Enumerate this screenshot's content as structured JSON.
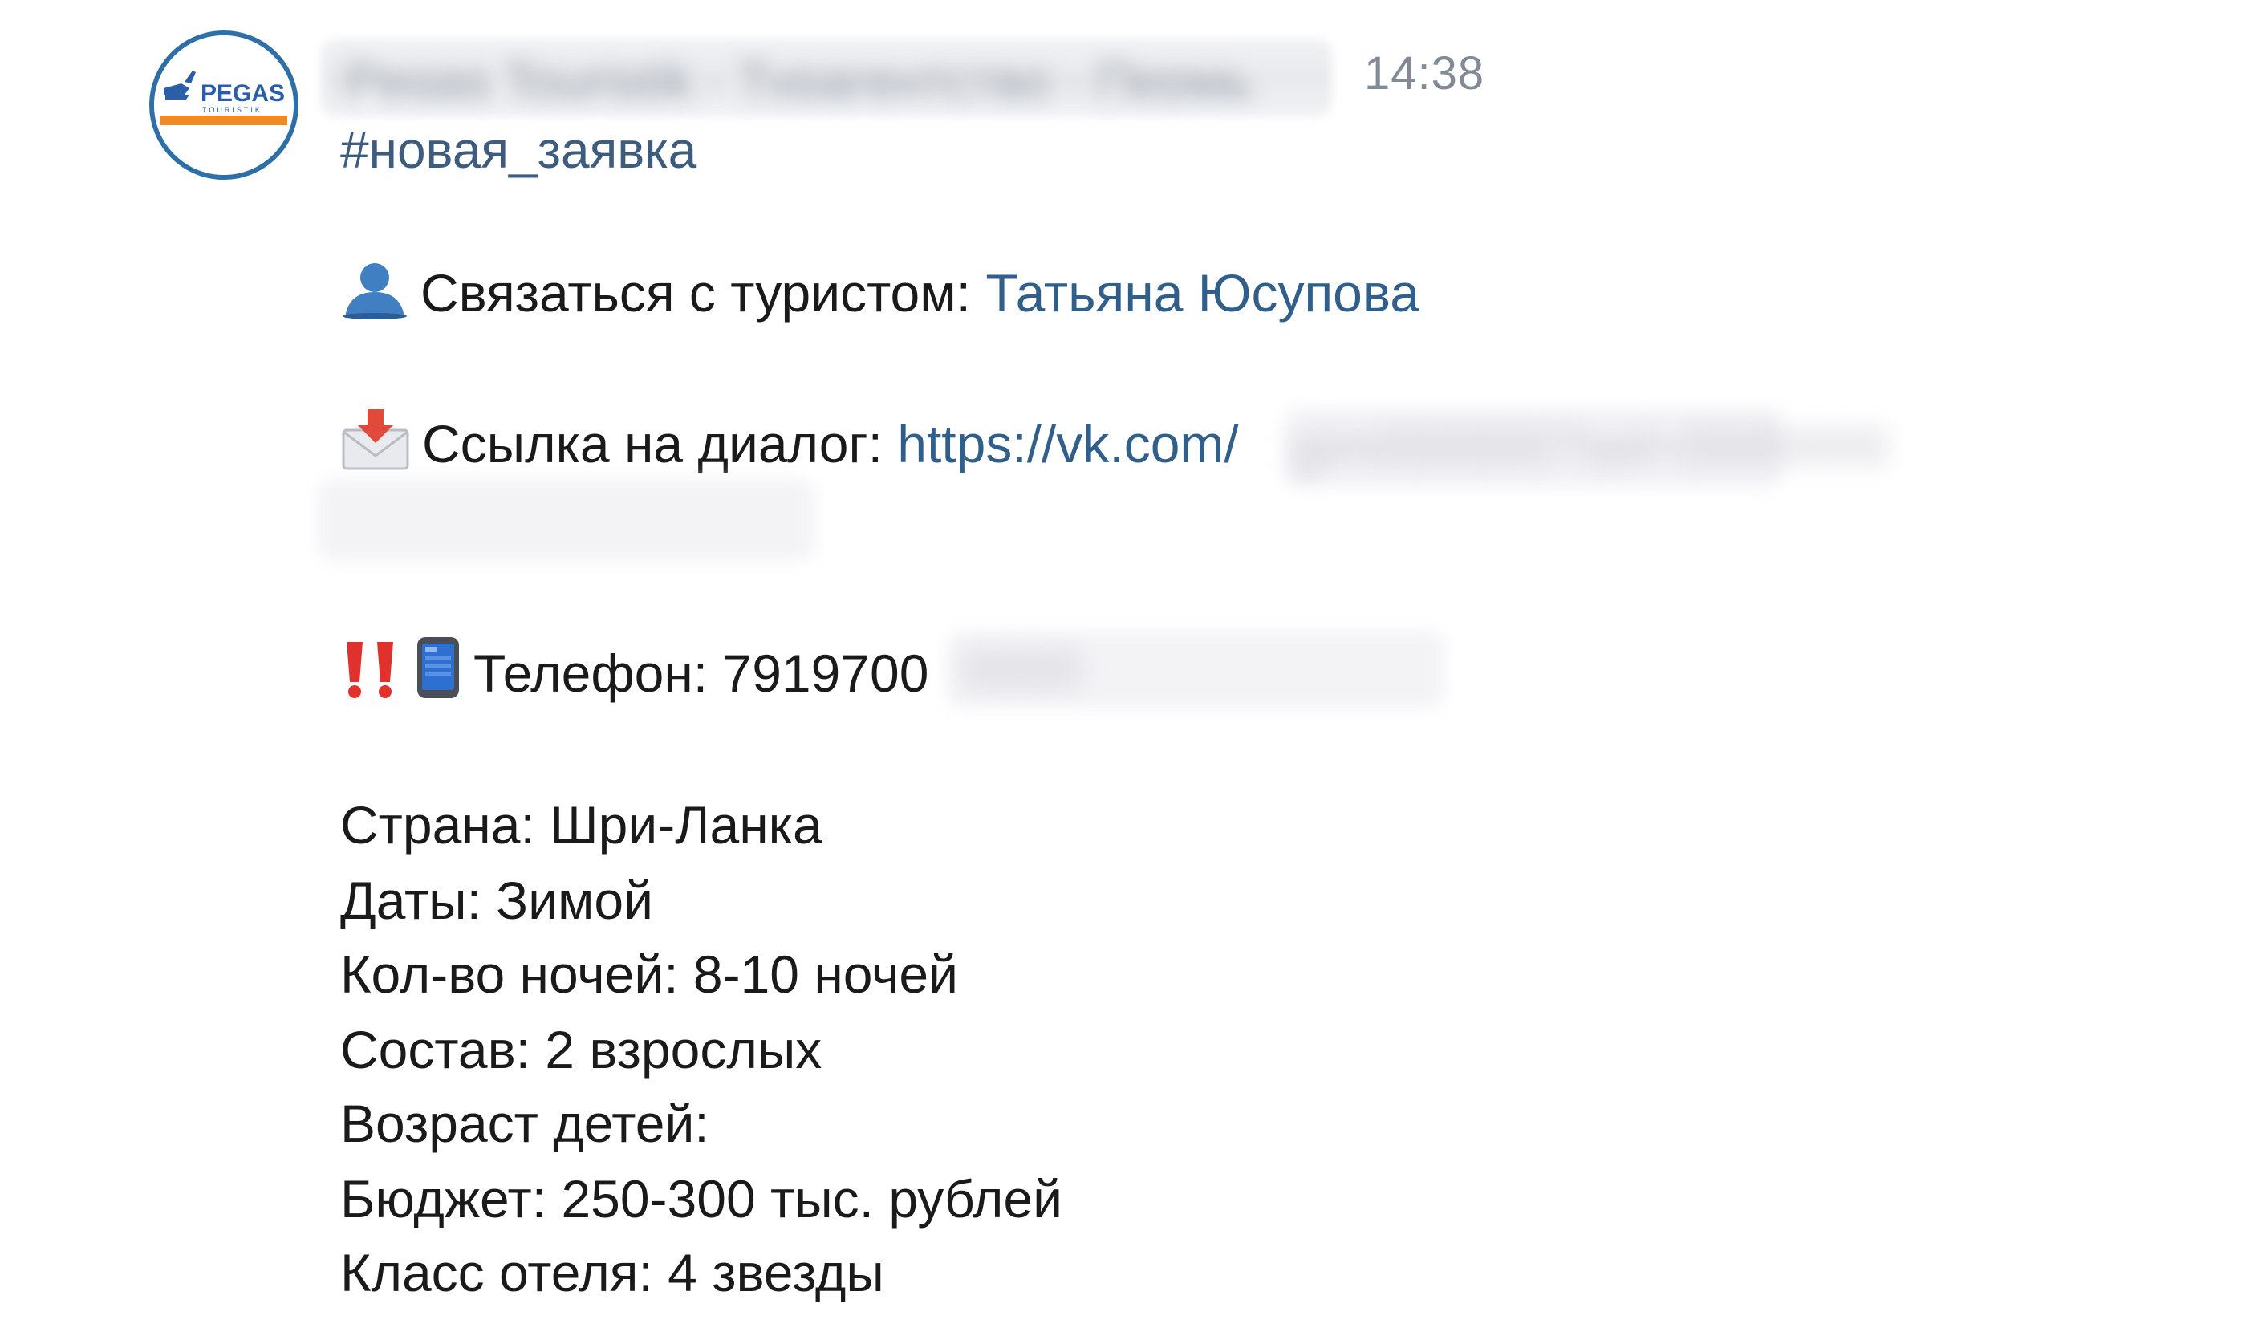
{
  "message": {
    "sender_name": "Pegas Touristik · Турагентство · Пермь",
    "time": "14:38",
    "hashtag": "#новая_заявка",
    "contact": {
      "label": "Связаться с туристом: ",
      "name": "Татьяна Юсупова"
    },
    "dialog": {
      "label": "Ссылка на диалог: ",
      "url_visible": "https://vk.com/",
      "url_hidden": "gim000000?sel=0000000"
    },
    "phone": {
      "label": "Телефон: ",
      "value": "7919700",
      "hidden": "0000"
    },
    "details": [
      "Страна: Шри-Ланка",
      "Даты: Зимой",
      "Кол-во ночей: 8-10 ночей",
      "Состав: 2 взрослых",
      "Возраст детей:",
      "Бюджет: 250-300 тыс. рублей",
      "Класс отеля: 4 звезды"
    ]
  },
  "avatar": {
    "logo_text": "PEGAS",
    "icon": "pegas-logo"
  },
  "icons": {
    "contact": "user-icon",
    "dialog": "incoming-envelope-icon",
    "urgent": "double-exclamation-icon",
    "phone": "mobile-phone-icon"
  },
  "colors": {
    "link": "#2f5f8a",
    "hashtag": "#3e5c7d",
    "time": "#828a96",
    "text": "#1a1a1a"
  }
}
